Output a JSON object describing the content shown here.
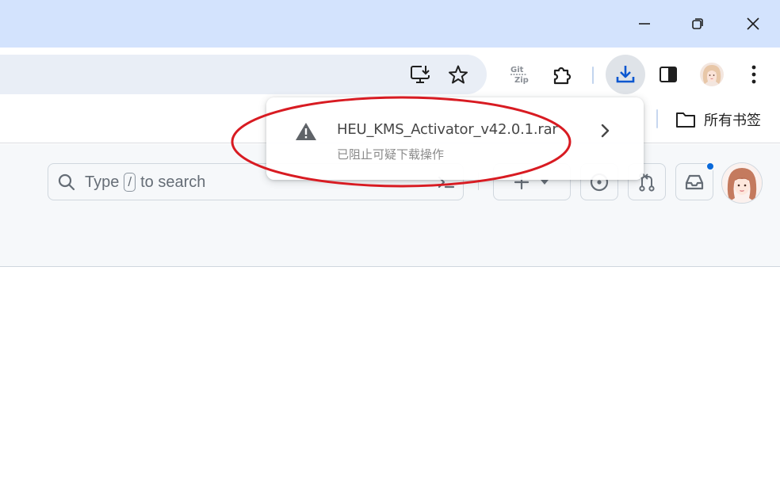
{
  "window": {
    "minimize_icon": "minimize-icon",
    "restore_icon": "restore-icon",
    "close_icon": "close-icon"
  },
  "toolbar": {
    "install_icon": "install-app-icon",
    "bookmark_icon": "star-icon",
    "extensions": [
      {
        "name": "gitzip-extension",
        "text_line1": "Git",
        "text_line2": "Zip"
      },
      {
        "name": "extensions-puzzle",
        "icon": "puzzle-icon"
      }
    ],
    "download_icon": "download-icon",
    "side_panel_icon": "side-panel-icon",
    "menu_icon": "kebab-menu-icon"
  },
  "bookmarks_bar": {
    "all_bookmarks_label": "所有书签",
    "folder_icon": "folder-icon"
  },
  "github_header": {
    "search": {
      "prefix": "Type",
      "shortcut_key": "/",
      "suffix": "to search"
    },
    "command_palette_icon": "terminal-icon",
    "create_icon": "plus-icon",
    "create_dropdown_icon": "triangle-down-icon",
    "issues_icon": "issue-opened-icon",
    "pull_requests_icon": "git-pull-request-icon",
    "inbox_icon": "inbox-icon",
    "unread_indicator_color": "#0969da"
  },
  "download_bubble": {
    "filename": "HEU_KMS_Activator_v42.0.1.rar",
    "status": "已阻止可疑下载操作",
    "warning_icon": "warning-triangle-icon",
    "details_icon": "chevron-right-icon"
  },
  "annotation": {
    "color": "#d81b22",
    "shape": "ellipse"
  },
  "colors": {
    "title_strip": "#d3e3fd",
    "omnibox": "#e9eef6",
    "download_active_blue": "#0b57d0",
    "github_header_bg": "#f6f8fa"
  }
}
